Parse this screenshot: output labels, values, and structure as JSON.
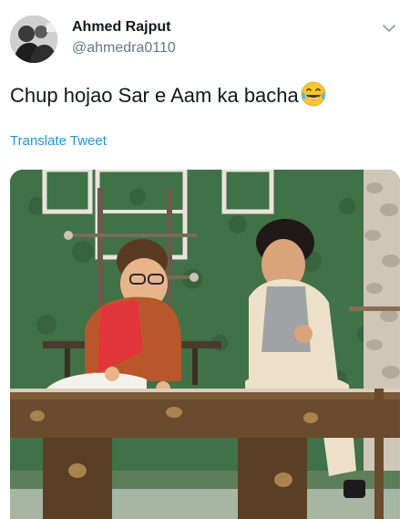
{
  "tweet": {
    "author_name": "Ahmed Rajput",
    "author_handle": "@ahmedra0110",
    "text": "Chup hojao Sar e Aam ka bacha",
    "emoji_icon": "face-with-tears-of-joy-icon",
    "translate_label": "Translate Tweet"
  },
  "media": {
    "type": "photo",
    "content": "two boys sitting on a wooden bench on a stage set"
  },
  "colors": {
    "text": "#14171a",
    "muted": "#657786",
    "link": "#1b95e0"
  }
}
